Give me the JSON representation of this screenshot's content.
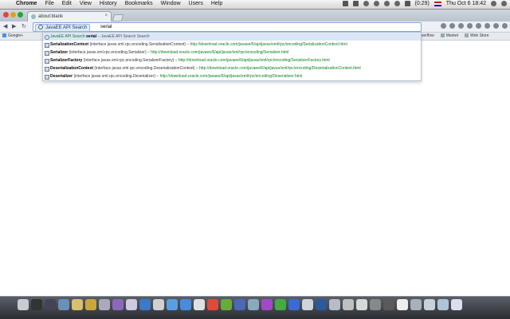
{
  "menubar": {
    "apple_glyph": "",
    "menus": [
      "Chrome",
      "File",
      "Edit",
      "View",
      "History",
      "Bookmarks",
      "Window",
      "Users",
      "Help"
    ],
    "battery": "(0:29)",
    "clock": "Thu Oct 6  18:42"
  },
  "tab": {
    "title": "about:blank",
    "close_glyph": "×"
  },
  "toolbar": {
    "back_glyph": "◀",
    "forward_glyph": "▶",
    "reload_glyph": "↻",
    "keyword_label": "JavaEE API Search",
    "query": "serial"
  },
  "bookmarks": {
    "google": "Google+",
    "right_items": [
      "Overflow",
      "Market",
      "Web Store"
    ]
  },
  "suggestions": [
    {
      "kw": "JavaEE API Search",
      "query": " serial",
      "label": " – JavaEE API Search Search"
    },
    {
      "title": "SerializationContext",
      "desc": " (interface javax.xml.rpc.encoding.SerializationContext)",
      "url": "http://download.oracle.com/javaee/6/api/javax/xml/rpc/encoding/SerializationContext.html"
    },
    {
      "title": "Serializer",
      "desc": " (interface javax.xml.rpc.encoding.Serializer)",
      "url": "http://download.oracle.com/javaee/6/api/javax/xml/rpc/encoding/Serializer.html"
    },
    {
      "title": "SerializerFactory",
      "desc": " (interface javax.xml.rpc.encoding.SerializerFactory)",
      "url": "http://download.oracle.com/javaee/6/api/javax/xml/rpc/encoding/SerializerFactory.html"
    },
    {
      "title": "DeserializationContext",
      "desc": " (interface javax.xml.rpc.encoding.DeserializationContext)",
      "url": "http://download.oracle.com/javaee/6/api/javax/xml/rpc/encoding/DeserializationContext.html"
    },
    {
      "title": "Deserializer",
      "desc": " (interface javax.xml.rpc.encoding.Deserializer)",
      "url": "http://download.oracle.com/javaee/6/api/javax/xml/rpc/encoding/Deserializer.html"
    }
  ],
  "url_separator": " – ",
  "dock": {
    "icon_colors": [
      "#c8ccd2",
      "#333",
      "#445",
      "#6a8fb8",
      "#d8c070",
      "#c9a640",
      "#aab",
      "#8a6ab8",
      "#ccd",
      "#3a7ac8",
      "#d0d0d0",
      "#5a9ee0",
      "#4a8ae0",
      "#e0e0e0",
      "#e04a3a",
      "#6aaa3a",
      "#4a6ab8",
      "#8ab",
      "#a04ac8",
      "#4a4",
      "#3a6ad8",
      "#d0d4da",
      "#2a5a9a",
      "#b8bcc4",
      "#c0c0c0",
      "#d8d8d8",
      "#888",
      "#5a5a5a",
      "#eee",
      "#a8b0bc",
      "#c8d0dc",
      "#b0c4d8",
      "#dde"
    ]
  }
}
